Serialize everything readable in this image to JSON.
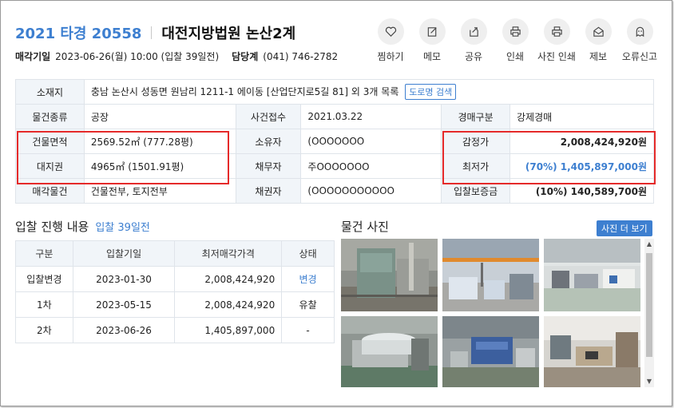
{
  "header": {
    "case_no": "2021 타경 20558",
    "court": "대전지방법원 논산2계",
    "sale_date_label": "매각기일",
    "sale_date_value": "2023-06-26(월) 10:00 (입찰 39일전)",
    "contact_label": "담당계",
    "contact_value": "(041) 746-2782"
  },
  "actions": [
    {
      "label": "찜하기",
      "icon": "heart-icon"
    },
    {
      "label": "메모",
      "icon": "memo-icon"
    },
    {
      "label": "공유",
      "icon": "share-icon"
    },
    {
      "label": "인쇄",
      "icon": "print-icon"
    },
    {
      "label": "사진 인쇄",
      "icon": "photo-print-icon"
    },
    {
      "label": "제보",
      "icon": "report-icon"
    },
    {
      "label": "오류신고",
      "icon": "error-report-icon"
    }
  ],
  "info": {
    "location_label": "소재지",
    "location_value": "충남 논산시 성동면 원남리 1211-1 에이동 [산업단지로5길 81] 외 3개 목록",
    "road_search": "도로명 검색",
    "type_label": "물건종류",
    "type_value": "공장",
    "filing_label": "사건접수",
    "filing_value": "2021.03.22",
    "auction_type_label": "경매구분",
    "auction_type_value": "강제경매",
    "building_area_label": "건물면적",
    "building_area_value": "2569.52㎡ (777.28평)",
    "owner_label": "소유자",
    "owner_value": "(OOOOOOO",
    "appraisal_label": "감정가",
    "appraisal_value": "2,008,424,920원",
    "land_label": "대지권",
    "land_value": "4965㎡ (1501.91평)",
    "debtor_label": "채무자",
    "debtor_value": "주OOOOOOO",
    "min_price_label": "최저가",
    "min_price_value": "(70%) 1,405,897,000원",
    "sale_items_label": "매각물건",
    "sale_items_value": "건물전부, 토지전부",
    "creditor_label": "채권자",
    "creditor_value": "(OOOOOOOOOOO",
    "deposit_label": "입찰보증금",
    "deposit_value": "(10%) 140,589,700원"
  },
  "bids": {
    "title": "입찰 진행 내용",
    "subtitle": "입찰 39일전",
    "headers": [
      "구분",
      "입찰기일",
      "최저매각가격",
      "상태"
    ],
    "rows": [
      [
        "입찰변경",
        "2023-01-30",
        "2,008,424,920",
        "변경"
      ],
      [
        "1차",
        "2023-05-15",
        "2,008,424,920",
        "유찰"
      ],
      [
        "2차",
        "2023-06-26",
        "1,405,897,000",
        "-"
      ]
    ]
  },
  "photos": {
    "title": "물건 사진",
    "more": "사진 더 보기",
    "count": 6
  },
  "colors": {
    "accent": "#3d7fd0",
    "highlight_box": "#e52a2a"
  }
}
